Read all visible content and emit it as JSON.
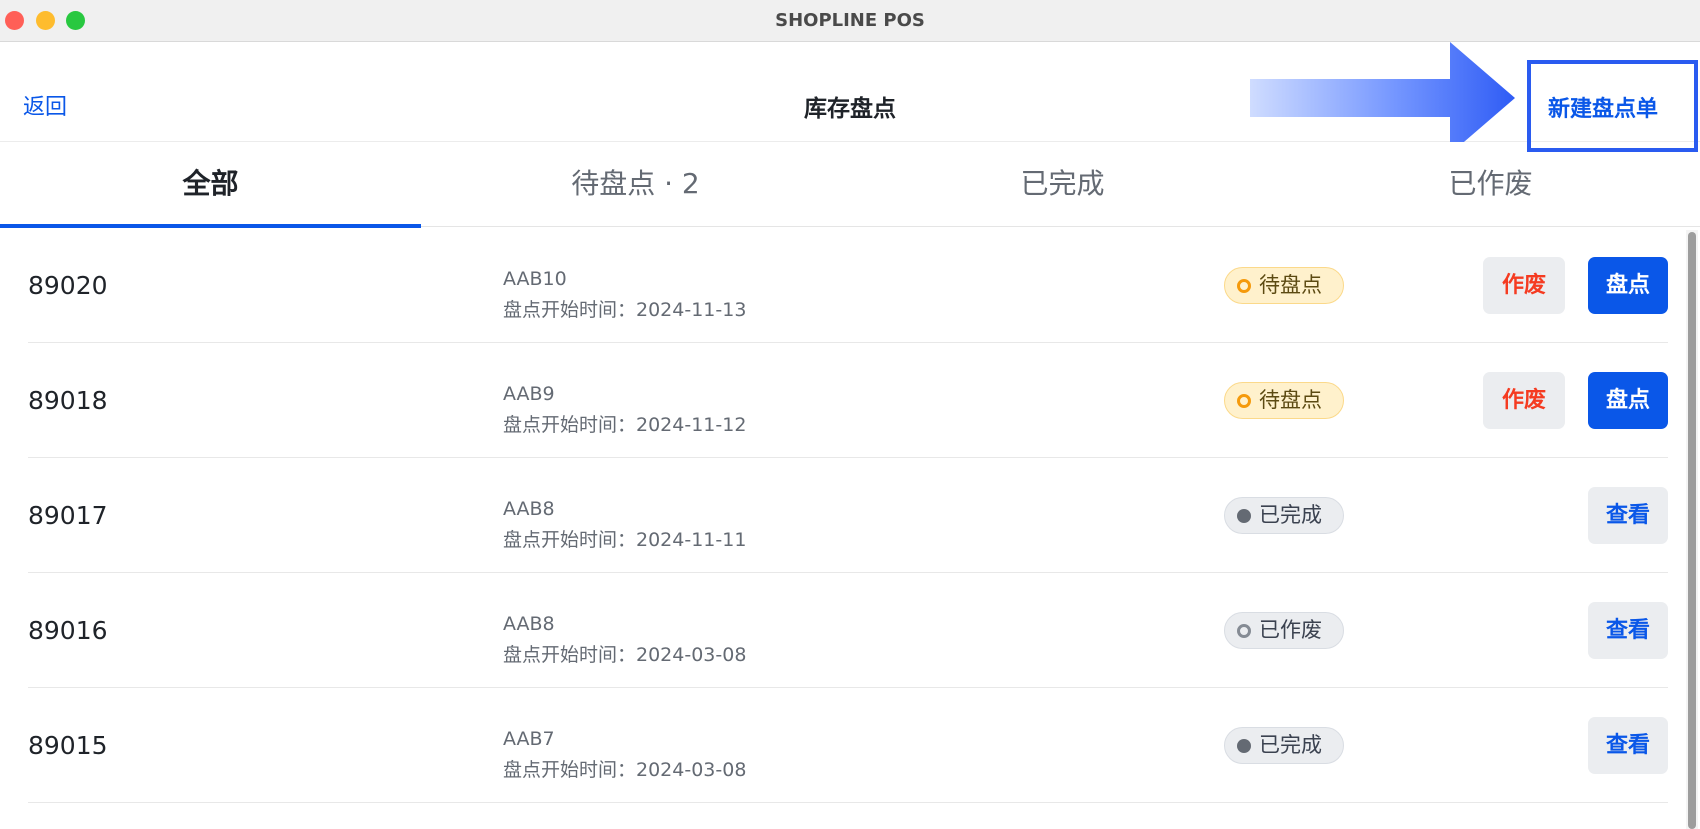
{
  "window": {
    "title": "SHOPLINE POS"
  },
  "header": {
    "back_label": "返回",
    "title": "库存盘点",
    "new_button_label": "新建盘点单"
  },
  "tabs": [
    {
      "label": "全部",
      "active": true
    },
    {
      "label": "待盘点 · 2",
      "active": false
    },
    {
      "label": "已完成",
      "active": false
    },
    {
      "label": "已作废",
      "active": false
    }
  ],
  "rows": [
    {
      "id": "89020",
      "code": "AAB10",
      "date": "盘点开始时间：2024-11-13",
      "status": "待盘点",
      "void_label": "作废",
      "action_label": "盘点"
    },
    {
      "id": "89018",
      "code": "AAB9",
      "date": "盘点开始时间：2024-11-12",
      "status": "待盘点",
      "void_label": "作废",
      "action_label": "盘点"
    },
    {
      "id": "89017",
      "code": "AAB8",
      "date": "盘点开始时间：2024-11-11",
      "status": "已完成",
      "action_label": "查看"
    },
    {
      "id": "89016",
      "code": "AAB8",
      "date": "盘点开始时间：2024-03-08",
      "status": "已作废",
      "action_label": "查看"
    },
    {
      "id": "89015",
      "code": "AAB7",
      "date": "盘点开始时间：2024-03-08",
      "status": "已完成",
      "action_label": "查看"
    }
  ],
  "colors": {
    "accent": "#0a57e8",
    "danger": "#f53b21",
    "pending_badge": "#fff1cc",
    "neutral_badge": "#ebedf0"
  },
  "icons": {
    "annotation_arrow": "arrow-right-icon"
  }
}
